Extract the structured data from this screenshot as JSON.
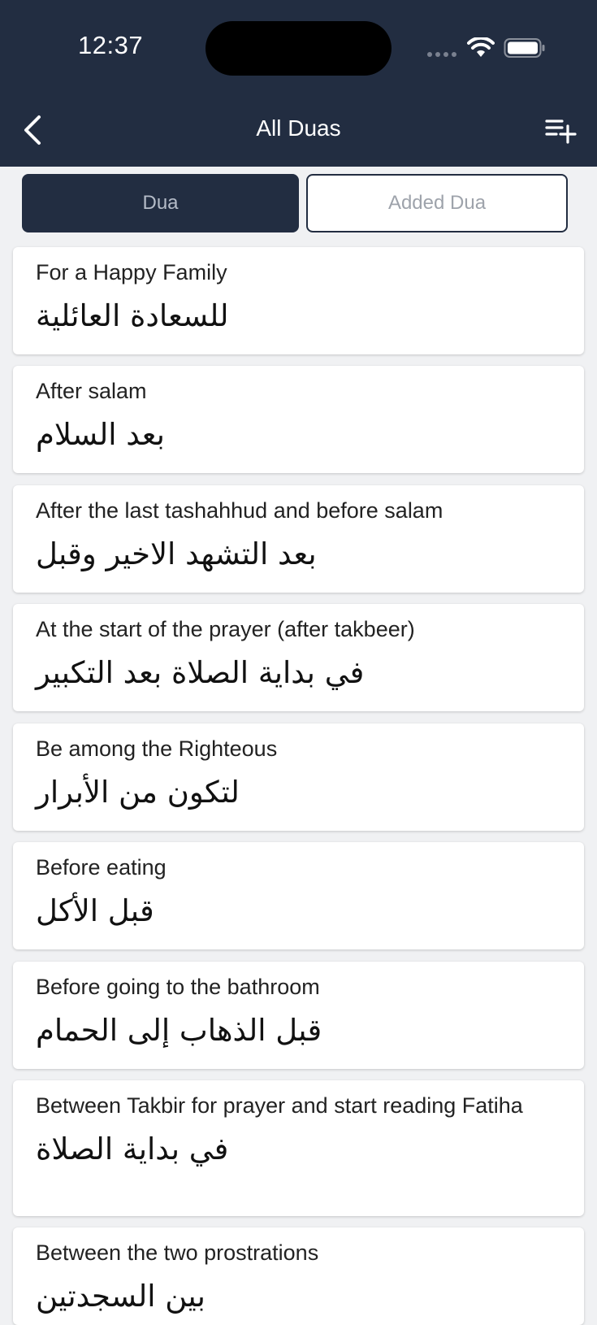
{
  "status_bar": {
    "time": "12:37"
  },
  "header": {
    "title": "All Duas",
    "back_icon": "chevron-left-icon",
    "add_icon": "playlist-add-icon"
  },
  "tabs": [
    {
      "label": "Dua",
      "active": true
    },
    {
      "label": "Added Dua",
      "active": false
    }
  ],
  "duas": [
    {
      "title": "For a Happy Family",
      "arabic": "للسعادة العائلية"
    },
    {
      "title": "After salam",
      "arabic": "بعد السلام"
    },
    {
      "title": "After the last tashahhud and before salam",
      "arabic": "بعد التشهد الاخير وقبل"
    },
    {
      "title": "At the start of the prayer (after takbeer)",
      "arabic": "في بداية الصلاة بعد التكبير"
    },
    {
      "title": "Be among the Righteous",
      "arabic": "لتكون من الأبرار"
    },
    {
      "title": "Before eating",
      "arabic": "قبل الأكل"
    },
    {
      "title": "Before going to the bathroom",
      "arabic": "قبل الذهاب إلى الحمام"
    },
    {
      "title": "Between Takbir for prayer and start reading Fatiha",
      "arabic": "في بداية الصلاة"
    },
    {
      "title": "Between the two prostrations",
      "arabic": "بين السجدتين"
    }
  ],
  "colors": {
    "header_bg": "#222d41",
    "page_bg": "#f0f1f3"
  }
}
